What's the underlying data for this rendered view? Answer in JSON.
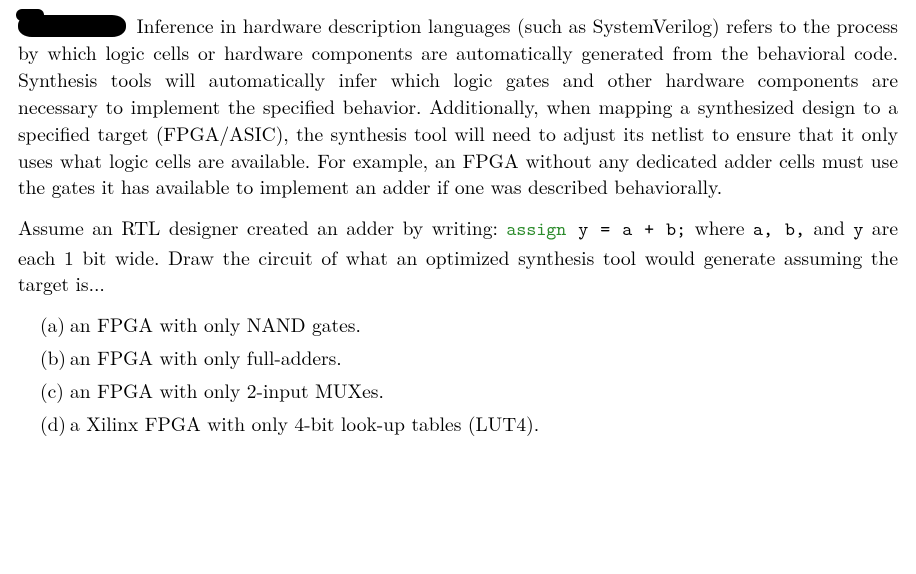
{
  "intro": {
    "text_after_redaction": "Inference in hardware description languages (such as SystemVerilog) refers to the process by which logic cells or hardware components are automatically generated from the behavioral code. Synthesis tools will automatically infer which logic gates and other hardware components are necessary to implement the specified behavior. Additionally, when mapping a synthesized design to a specified target (FPGA/ASIC), the synthesis tool will need to adjust its netlist to ensure that it only uses what logic cells are available. For example, an FPGA without any dedicated adder cells must use the gates it has available to implement an adder if one was described behaviorally."
  },
  "setup": {
    "pre": "Assume an RTL designer created an adder by writing: ",
    "kw": "assign",
    "code_rest": " y = a + b;",
    "post1": " where ",
    "vars": "a, b,",
    "post2": " and ",
    "vary": "y",
    "post3": " are each 1 bit wide.  Draw the circuit of what an optimized synthesis tool would generate assuming the target is..."
  },
  "parts": [
    {
      "marker": "(a)",
      "text": "an FPGA with only NAND gates."
    },
    {
      "marker": "(b)",
      "text": "an FPGA with only full-adders."
    },
    {
      "marker": "(c)",
      "text": "an FPGA with only 2-input MUXes."
    },
    {
      "marker": "(d)",
      "text": "a Xilinx FPGA with only 4-bit look-up tables (LUT4)."
    }
  ]
}
